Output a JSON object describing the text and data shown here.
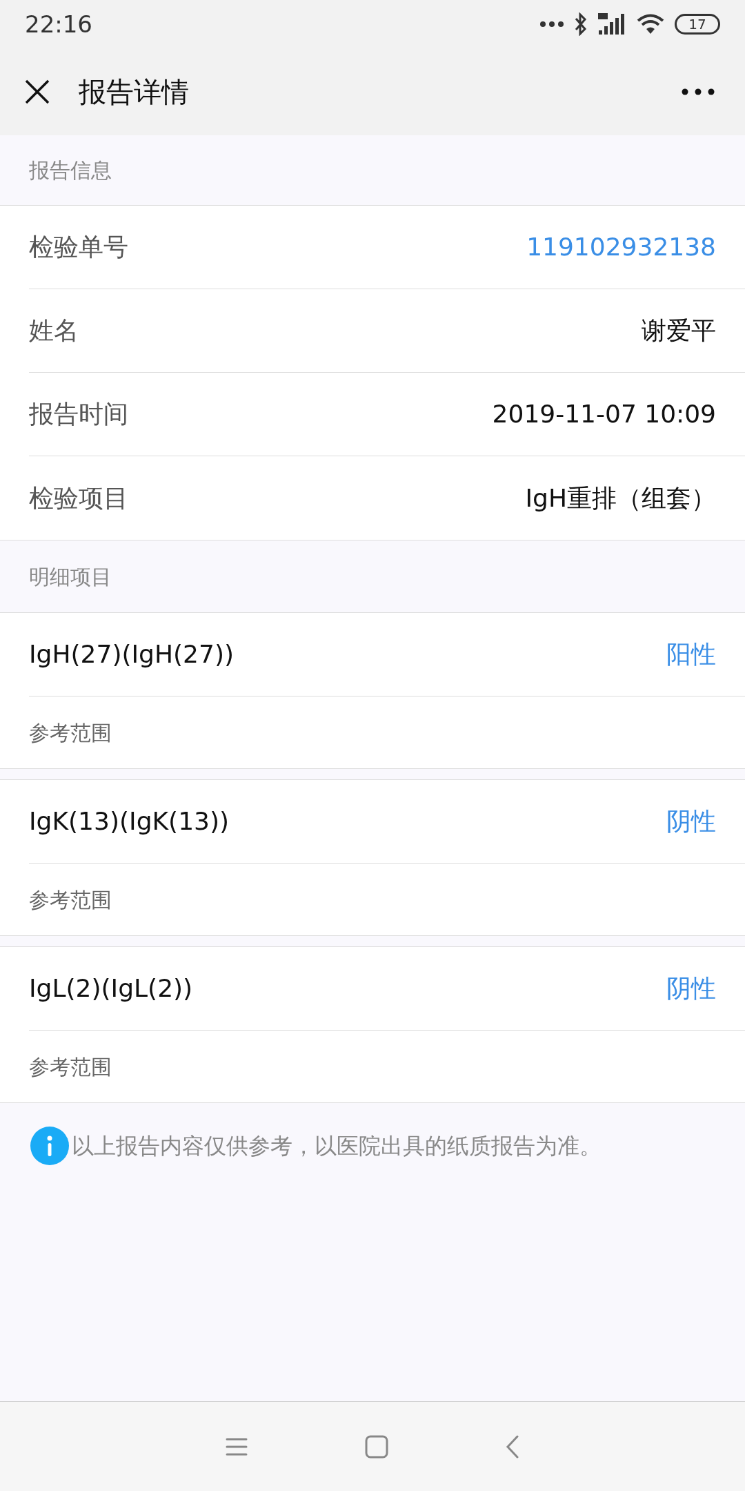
{
  "status_bar": {
    "time": "22:16",
    "battery": "17"
  },
  "toolbar": {
    "title": "报告详情"
  },
  "report_info": {
    "header": "报告信息",
    "rows": [
      {
        "label": "检验单号",
        "value": "119102932138",
        "kind": "link"
      },
      {
        "label": "姓名",
        "value": "谢爱平",
        "kind": "plain"
      },
      {
        "label": "报告时间",
        "value": "2019-11-07 10:09",
        "kind": "plain"
      },
      {
        "label": "检验项目",
        "value": "IgH重排（组套）",
        "kind": "plain"
      }
    ]
  },
  "details": {
    "header": "明细项目",
    "items": [
      {
        "name": "IgH(27)(IgH(27))",
        "result": "阳性",
        "reference_label": "参考范围"
      },
      {
        "name": "IgK(13)(IgK(13))",
        "result": "阴性",
        "reference_label": "参考范围"
      },
      {
        "name": "IgL(2)(IgL(2))",
        "result": "阴性",
        "reference_label": "参考范围"
      }
    ]
  },
  "note": "以上报告内容仅供参考，以医院出具的纸质报告为准。"
}
